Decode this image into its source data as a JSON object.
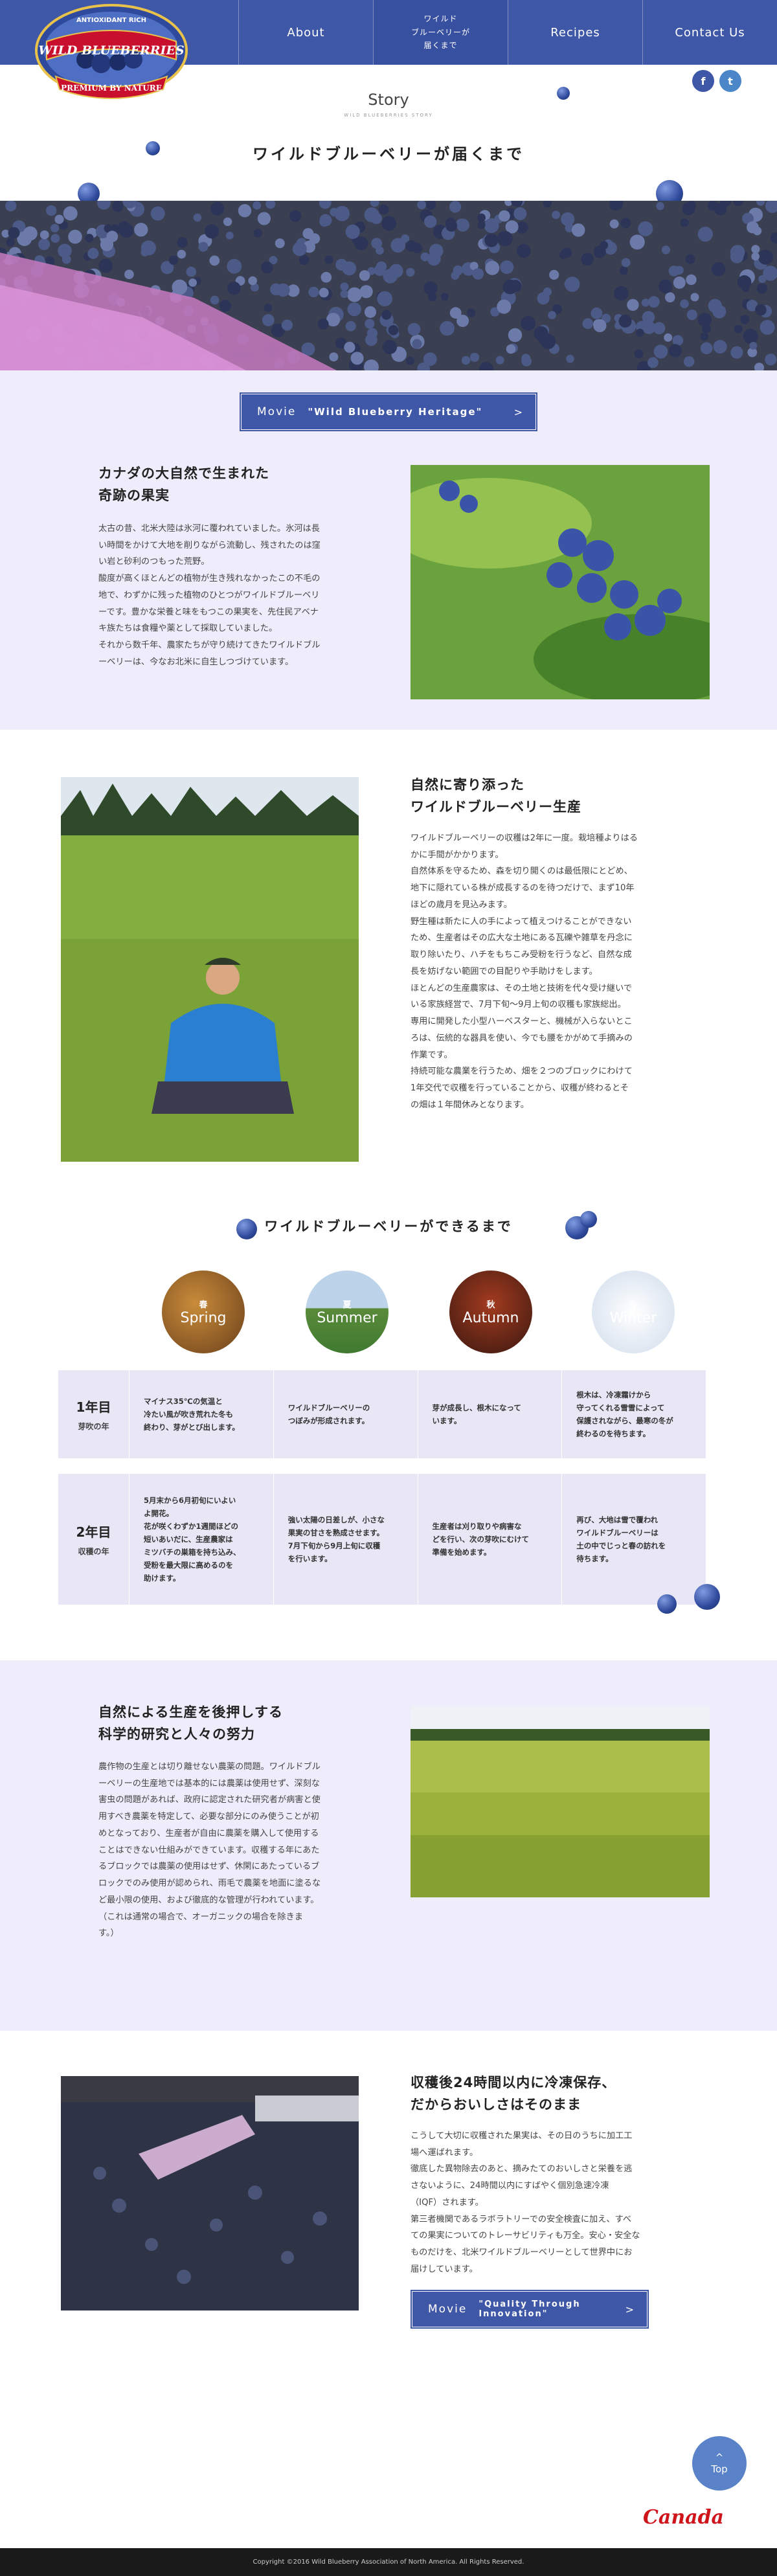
{
  "header": {
    "logo": {
      "top_text": "ANTIOXIDANT RICH",
      "main_text": "WILD BLUEBERRIES",
      "bottom_text": "PREMIUM BY NATURE"
    },
    "nav": [
      {
        "label": "About"
      },
      {
        "label": "ワイルド\nブルーベリーが\n届くまで"
      },
      {
        "label": "Recipes"
      },
      {
        "label": "Contact Us"
      }
    ],
    "social": {
      "facebook": "f",
      "twitter": "t"
    }
  },
  "intro": {
    "story_label": "Story",
    "story_sub": "WILD BLUEBERRIES STORY",
    "title": "ワイルドブルーベリーが届くまで"
  },
  "movie1": {
    "prefix": "Movie",
    "title": "\"Wild Blueberry Heritage\"",
    "arrow": ">"
  },
  "section1": {
    "title": "カナダの大自然で生まれた\n奇跡の果実",
    "body": "太古の昔、北米大陸は氷河に覆われていました。氷河は長\nい時間をかけて大地を削りながら流動し、残されたのは窪\nい岩と砂利のつもった荒野。\n酸度が高くほとんどの植物が生き残れなかったこの不毛の\n地で、わずかに残った植物のひとつがワイルドブルーベリ\nーです。豊かな栄養と味をもつこの果実を、先住民アベナ\nキ族たちは食糧や薬として採取していました。\nそれから数千年、農家たちが守り続けてきたワイルドブル\nーベリーは、今なお北米に自生しつづけています。"
  },
  "section2": {
    "title": "自然に寄り添った\nワイルドブルーベリー生産",
    "body": "ワイルドブルーベリーの収穫は2年に一度。栽培種よりはる\nかに手間がかかります。\n自然体系を守るため、森を切り開くのは最低限にとどめ、\n地下に隠れている株が成長するのを待つだけで、まず10年\nほどの歳月を見込みます。\n野生種は新たに人の手によって植えつけることができない\nため、生産者はその広大な土地にある瓦礫や雑草を丹念に\n取り除いたり、ハチをもちこみ受粉を行うなど、自然な成\n長を妨げない範囲での目配りや手助けをします。\nほとんどの生産農家は、その土地と技術を代々受け継いで\nいる家族経営で、7月下旬〜9月上旬の収穫も家族総出。\n専用に開発した小型ハーベスターと、機械が入らないとこ\nろは、伝統的な器具を使い、今でも腰をかがめて手摘みの\n作業です。\n持続可能な農業を行うため、畑を２つのブロックにわけて\n1年交代で収穫を行っていることから、収穫が終わるとそ\nの畑は１年間休みとなります。"
  },
  "cycle": {
    "title": "ワイルドブルーベリーができるまで",
    "seasons": [
      {
        "kanji": "春",
        "english": "Spring"
      },
      {
        "kanji": "夏",
        "english": "Summer"
      },
      {
        "kanji": "秋",
        "english": "Autumn"
      },
      {
        "kanji": "冬",
        "english": "Winter"
      }
    ],
    "years": [
      {
        "label": "1年目",
        "sub": "芽吹の年",
        "cells": [
          "マイナス35℃の気温と\n冷たい風が吹き荒れた冬も\n終わり、芽がとび出します。",
          "ワイルドブルーベリーの\nつぼみが形成されます。",
          "芽が成長し、根木になって\nいます。",
          "根木は、冷凍霜けから\n守ってくれる雪雪によって\n保護されながら、最寒の冬が\n終わるのを待ちます。"
        ]
      },
      {
        "label": "2年目",
        "sub": "収穫の年",
        "cells": [
          "5月末から6月初旬にいよい\nよ開花。\n花が咲くわずか1週間ほどの\n短いあいだに、生産農家は\nミツバチの巣箱を持ち込み、\n受粉を最大限に高めるのを\n助けます。",
          "強い太陽の日差しが、小さな\n果実の甘さを熟成させます。\n7月下旬から9月上旬に収穫\nを行います。",
          "生産者は刈り取りや病害な\nどを行い、次の芽吹にむけて\n準備を始めます。",
          "再び、大地は雪で覆われ\nワイルドブルーベリーは\n土の中でじっと春の訪れを\n待ちます。"
        ]
      }
    ]
  },
  "section3": {
    "title": "自然による生産を後押しする\n科学的研究と人々の努力",
    "body": "農作物の生産とは切り離せない農薬の問題。ワイルドブル\nーベリーの生産地では基本的には農薬は使用せず、深刻な\n害虫の問題があれば、政府に認定された研究者が病害と使\n用すべき農薬を特定して、必要な部分にのみ使うことが初\nめとなっており、生産者が自由に農薬を購入して使用する\nことはできない仕組みができています。収穫する年にあた\nるブロックでは農薬の使用はせず、休閑にあたっているブ\nロックでのみ使用が認められ、雨毛で農薬を地面に塗るな\nど最小限の使用、および徹底的な管理が行われています。\n（これは通常の場合で、オーガニックの場合を除きま\nす。）"
  },
  "section4": {
    "title": "収穫後24時間以内に冷凍保存、\nだからおいしさはそのまま",
    "body": "こうして大切に収穫された果実は、その日のうちに加工工\n場へ運ばれます。\n徹底した異物除去のあと、摘みたてのおいしさと栄養を逃\nさないように、24時間以内にすばやく個別急速冷凍\n（IQF）されます。\n第三者機関であるラボラトリーでの安全検査に加え、すべ\nての果実についてのトレーサビリティも万全。安心・安全な\nものだけを、北米ワイルドブルーベリーとして世界中にお\n届けしています。"
  },
  "movie2": {
    "prefix": "Movie",
    "title": "\"Quality Through Innovation\"",
    "arrow": ">"
  },
  "top_button": {
    "arrow": "^",
    "label": "Top"
  },
  "canada_logo": "Canada",
  "footer": {
    "copyright": "Copyright ©2016 Wild Blueberry Association of North America. All Rights Reserved."
  },
  "colors": {
    "brand": "#3f57a7",
    "band": "#efedfb",
    "footer": "#1a1a1a",
    "canada_red": "#d0141c"
  }
}
